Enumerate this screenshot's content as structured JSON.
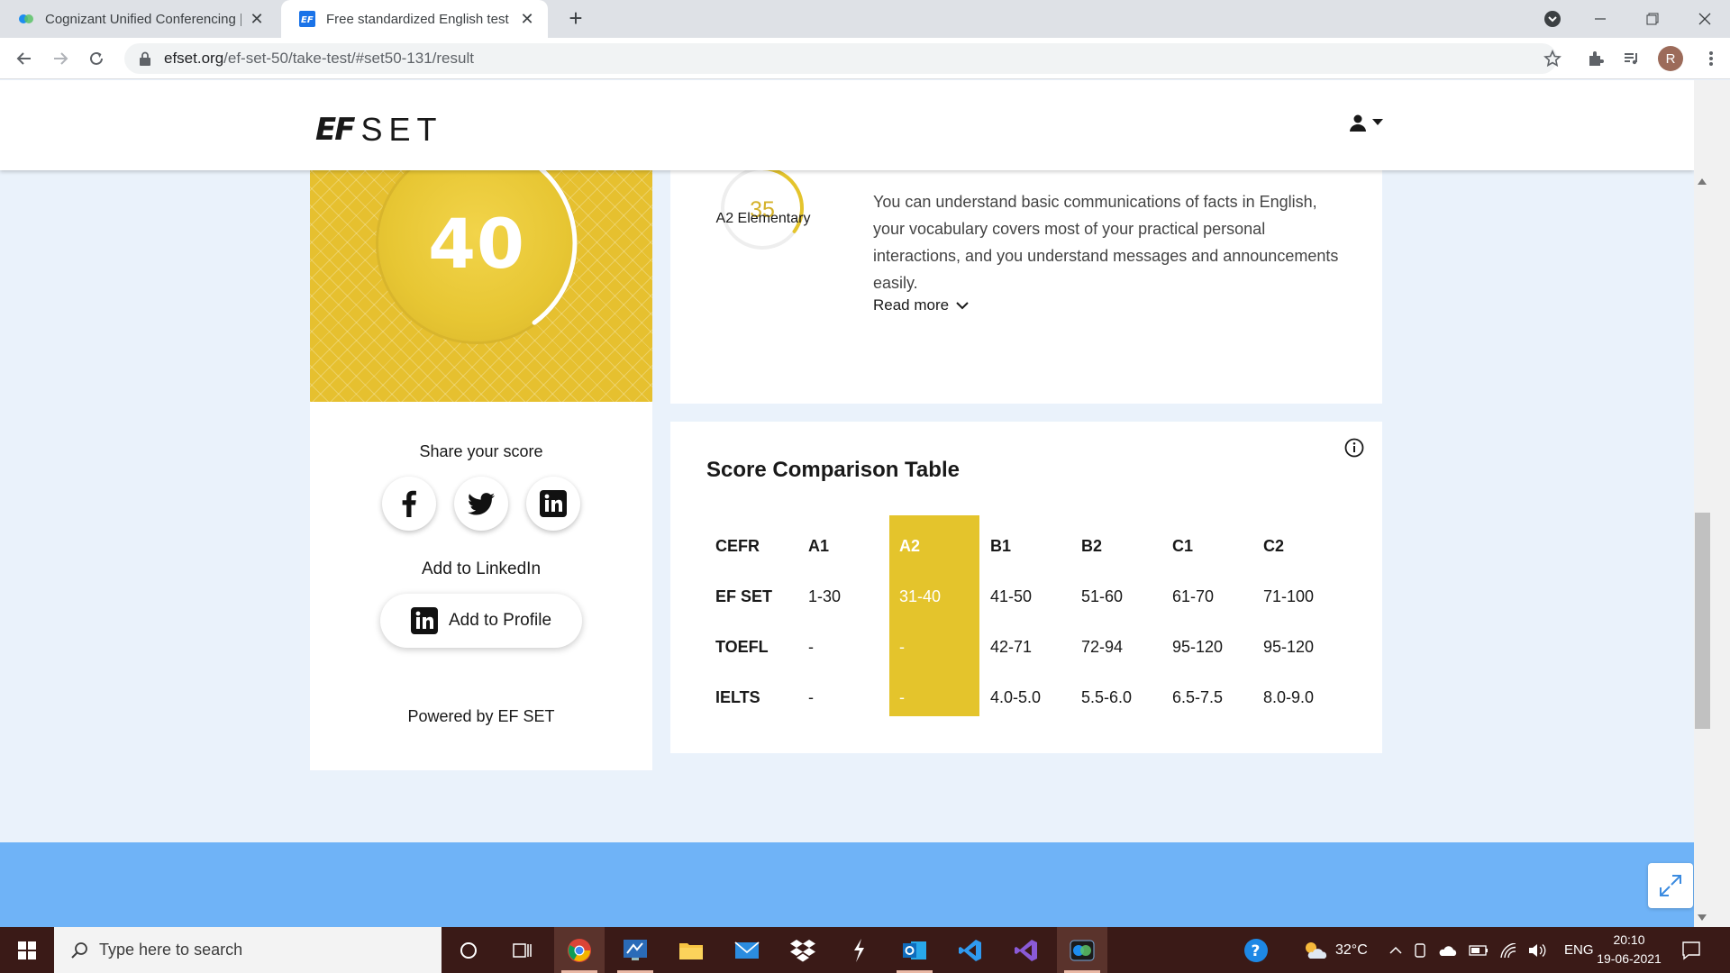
{
  "browser": {
    "tabs": [
      {
        "title": "Cognizant Unified Conferencing |",
        "active": false
      },
      {
        "title": "Free standardized English test ca",
        "active": true
      }
    ],
    "url_host": "efset.org",
    "url_path": "/ef-set-50/take-test/#set50-131/result",
    "profile_initial": "R"
  },
  "site": {
    "logo_ef": "EF",
    "logo_set": "SET"
  },
  "score": {
    "value": "40",
    "progress_fraction": 0.4,
    "share_title": "Share your score",
    "linkedin_title": "Add to LinkedIn",
    "add_profile_label": "Add to Profile",
    "powered_by": "Powered by EF SET"
  },
  "level": {
    "value": "35",
    "progress_fraction": 0.35,
    "name": "A2 Elementary",
    "description": "You can understand basic communications of facts in English, your vocabulary covers most of your practical personal interactions, and you understand messages and announcements easily.",
    "read_more": "Read more"
  },
  "comparison": {
    "title": "Score Comparison Table",
    "highlight_column": 2,
    "rows": [
      [
        "CEFR",
        "A1",
        "A2",
        "B1",
        "B2",
        "C1",
        "C2"
      ],
      [
        "EF SET",
        "1-30",
        "31-40",
        "41-50",
        "51-60",
        "61-70",
        "71-100"
      ],
      [
        "TOEFL",
        "-",
        "-",
        "42-71",
        "72-94",
        "95-120",
        "95-120"
      ],
      [
        "IELTS",
        "-",
        "-",
        "4.0-5.0",
        "5.5-6.0",
        "6.5-7.5",
        "8.0-9.0"
      ]
    ]
  },
  "taskbar": {
    "search_placeholder": "Type here to search",
    "weather": "32°C",
    "language": "ENG",
    "time": "20:10",
    "date": "19-06-2021"
  },
  "colors": {
    "accent_yellow": "#e4c42c",
    "footer_blue": "#6fb3f7",
    "page_bg": "#eaf2fb"
  }
}
